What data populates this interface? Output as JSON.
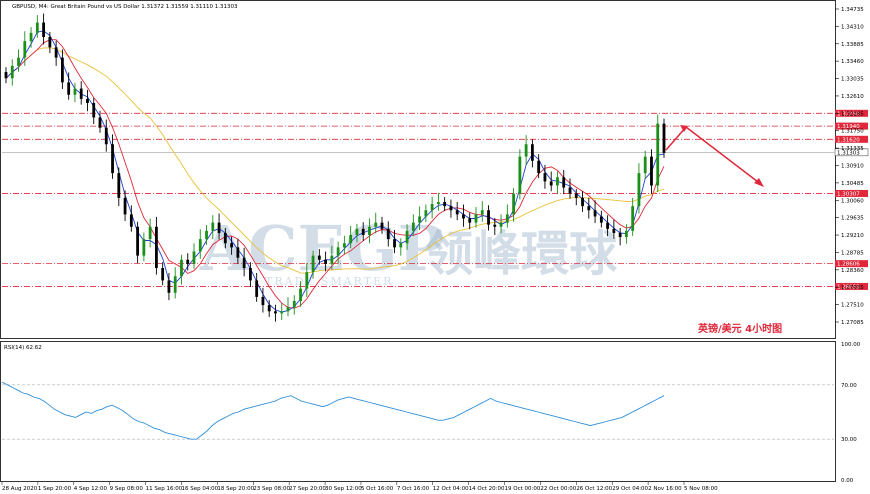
{
  "chart_data": {
    "type": "candlestick",
    "symbol_header": "GBPUSD, M4:  Great Britain Pound vs US Dollar  1.31372  1.31559  1.31110  1.31303",
    "annotation": "英镑/美元  4小时图",
    "watermark": {
      "latin": "ACEGP",
      "sub": "TRADE SMARTER",
      "chinese": "领峰環球"
    },
    "price_axis_ticks": [
      "1.34735",
      "1.34310",
      "1.33885",
      "1.33460",
      "1.33035",
      "1.32610",
      "1.32185",
      "1.31750",
      "1.31335",
      "1.30910",
      "1.30485",
      "1.30060",
      "1.29635",
      "1.29210",
      "1.28785",
      "1.28360",
      "1.27935",
      "1.27510",
      "1.27085"
    ],
    "ylim": [
      1.269,
      1.349
    ],
    "time_labels": [
      "28 Aug 2020",
      "1 Sep 20:00",
      "4 Sep 12:00",
      "9 Sep 08:00",
      "11 Sep 16:00",
      "16 Sep 04:00",
      "18 Sep 20:00",
      "23 Sep 08:00",
      "27 Sep 20:00",
      "30 Sep 12:00",
      "5 Oct 16:00",
      "7 Oct 16:00",
      "12 Oct 04:00",
      "14 Oct 20:00",
      "19 Oct 00:00",
      "22 Oct 00:00",
      "26 Oct 12:00",
      "29 Oct 04:00",
      "2 Nov 16:00",
      "5 Nov 08:00"
    ],
    "horizontal_levels": [
      {
        "value": 1.3225,
        "label": "1.32250"
      },
      {
        "value": 1.3194,
        "label": "1.31940"
      },
      {
        "value": 1.3162,
        "label": "1.31620"
      },
      {
        "value": 1.30307,
        "label": "1.30307"
      },
      {
        "value": 1.28606,
        "label": "1.28606"
      },
      {
        "value": 1.28053,
        "label": "1.28053"
      }
    ],
    "current_price": {
      "value": 1.31303,
      "label": "1.31303"
    },
    "close_series": [
      1.331,
      1.334,
      1.336,
      1.34,
      1.342,
      1.3445,
      1.341,
      1.3385,
      1.336,
      1.33,
      1.327,
      1.3285,
      1.326,
      1.325,
      1.3215,
      1.319,
      1.315,
      1.308,
      1.302,
      1.298,
      1.295,
      1.288,
      1.292,
      1.295,
      1.285,
      1.282,
      1.279,
      1.283,
      1.287,
      1.286,
      1.289,
      1.292,
      1.294,
      1.296,
      1.2935,
      1.291,
      1.29,
      1.2875,
      1.285,
      1.282,
      1.278,
      1.276,
      1.2745,
      1.274,
      1.2745,
      1.2755,
      1.277,
      1.28,
      1.284,
      1.288,
      1.287,
      1.286,
      1.288,
      1.29,
      1.291,
      1.293,
      1.2945,
      1.293,
      1.295,
      1.296,
      1.2945,
      1.292,
      1.29,
      1.291,
      1.294,
      1.296,
      1.2975,
      1.299,
      1.3005,
      1.301,
      1.3,
      1.299,
      1.298,
      1.297,
      1.296,
      1.298,
      1.299,
      1.2955,
      1.295,
      1.296,
      1.298,
      1.303,
      1.312,
      1.315,
      1.311,
      1.308,
      1.306,
      1.305,
      1.307,
      1.3045,
      1.303,
      1.302,
      1.3,
      1.299,
      1.2975,
      1.296,
      1.2945,
      1.2935,
      1.2925,
      1.294,
      1.3,
      1.308,
      1.312,
      1.305,
      1.32,
      1.3129
    ],
    "rsi": {
      "label": "RSI(14) 62.62",
      "value": 62.62,
      "ylim": [
        0,
        100
      ],
      "ticks": [
        "100.00",
        "70.00",
        "30.00",
        "0.00"
      ],
      "levels": [
        70,
        30
      ],
      "series": [
        72,
        70,
        68,
        66,
        64,
        63,
        61,
        60,
        58,
        55,
        52,
        50,
        48,
        47,
        46,
        48,
        50,
        49,
        51,
        52,
        54,
        55,
        53,
        51,
        48,
        45,
        43,
        42,
        40,
        38,
        37,
        35,
        34,
        33,
        32,
        31,
        30,
        30,
        33,
        36,
        40,
        43,
        45,
        47,
        49,
        50,
        52,
        53,
        54,
        55,
        56,
        57,
        58,
        60,
        61,
        62,
        60,
        58,
        57,
        56,
        55,
        54,
        55,
        57,
        59,
        60,
        61,
        60,
        59,
        58,
        57,
        56,
        55,
        54,
        53,
        52,
        51,
        50,
        49,
        48,
        47,
        46,
        45,
        44,
        44,
        45,
        46,
        48,
        50,
        52,
        54,
        56,
        58,
        60,
        58,
        57,
        56,
        55,
        54,
        53,
        52,
        51,
        50,
        49,
        48,
        47,
        46,
        45,
        44,
        43,
        42,
        41,
        40,
        41,
        42,
        43,
        44,
        45,
        46,
        48,
        50,
        52,
        54,
        56,
        58,
        60,
        62
      ]
    },
    "ma_colors": {
      "fast": "#1f3fd8",
      "mid": "#e0283a",
      "slow": "#e8c23a"
    },
    "arrow_color": "#e0283a",
    "up_color": "#1a8f1a",
    "down_color": "#000000"
  }
}
